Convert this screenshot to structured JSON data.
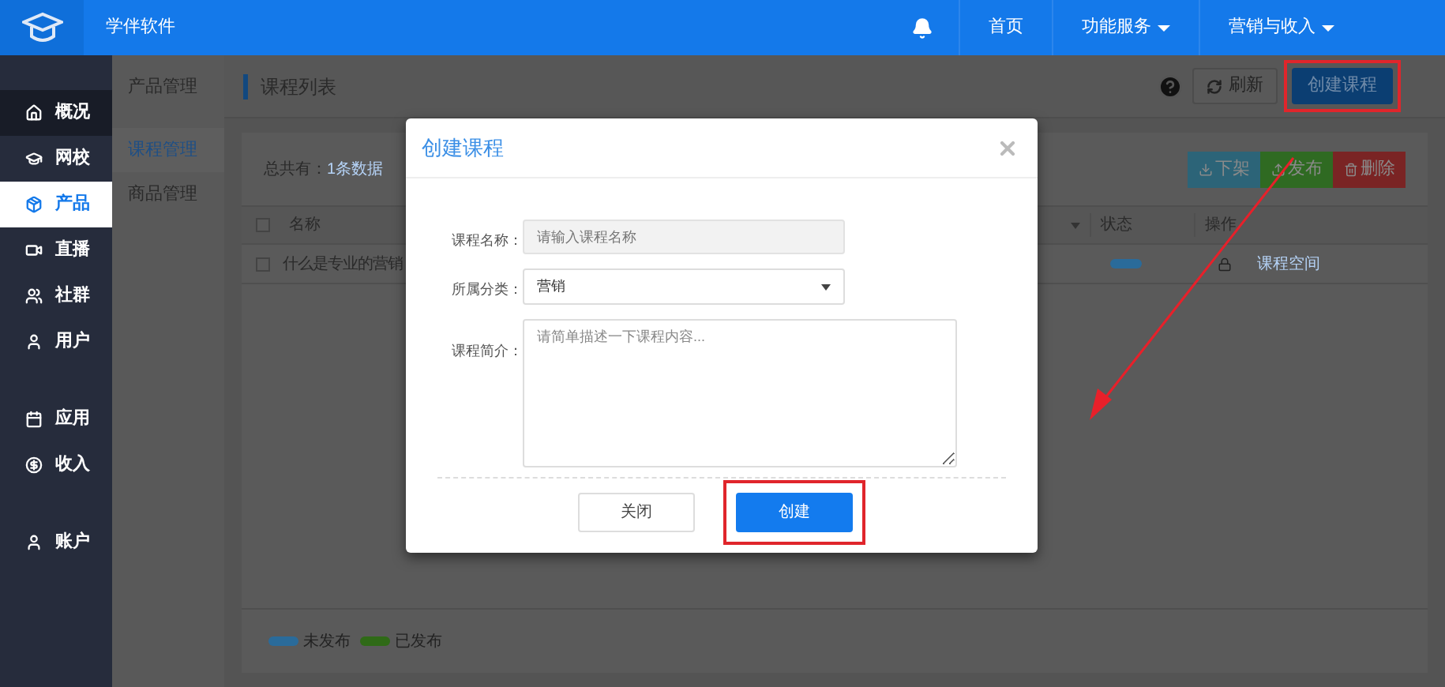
{
  "topbar": {
    "brand": "学伴软件",
    "nav": [
      {
        "label": "首页",
        "dropdown": false
      },
      {
        "label": "功能服务",
        "dropdown": true
      },
      {
        "label": "营销与收入",
        "dropdown": true
      }
    ]
  },
  "sidebar": {
    "groups": [
      [
        {
          "label": "概况",
          "selected": false
        },
        {
          "label": "网校",
          "selected": false
        },
        {
          "label": "产品",
          "selected": true
        },
        {
          "label": "直播",
          "selected": false
        },
        {
          "label": "社群",
          "selected": false
        },
        {
          "label": "用户",
          "selected": false
        }
      ],
      [
        {
          "label": "应用",
          "selected": false
        },
        {
          "label": "收入",
          "selected": false
        }
      ],
      [
        {
          "label": "账户",
          "selected": false
        }
      ]
    ]
  },
  "subnav": {
    "title": "产品管理",
    "items": [
      {
        "label": "课程管理",
        "selected": true
      },
      {
        "label": "商品管理",
        "selected": false
      }
    ]
  },
  "header": {
    "title": "课程列表",
    "refresh": "刷新",
    "create": "创建课程"
  },
  "list": {
    "total_label": "总共有：",
    "total": "1条数据",
    "actions": [
      {
        "label": "下架",
        "kind": "unpublish"
      },
      {
        "label": "发布",
        "kind": "publish"
      },
      {
        "label": "删除",
        "kind": "delete"
      }
    ],
    "header_checked": false,
    "columns": [
      "名称",
      "状态",
      "操作"
    ],
    "rows": [
      {
        "checked": false,
        "name": "什么是专业的营销",
        "color": "#2a6b9a",
        "action": "课程空间"
      }
    ],
    "legend": [
      {
        "label": "未发布",
        "color": "#2a6b9a"
      },
      {
        "label": "已发布",
        "color": "#2f6a17"
      }
    ]
  },
  "dialog": {
    "title": "创建课程",
    "fields": [
      {
        "kind": "input",
        "label": "课程名称：",
        "placeholder": "请输入课程名称"
      },
      {
        "kind": "select",
        "label": "所属分类：",
        "value": "营销"
      },
      {
        "kind": "textarea",
        "label": "课程简介：",
        "placeholder": "请简单描述一下课程内容..."
      }
    ],
    "buttons": [
      {
        "label": "关闭",
        "kind": "secondary"
      },
      {
        "label": "创建",
        "kind": "primary"
      }
    ]
  }
}
